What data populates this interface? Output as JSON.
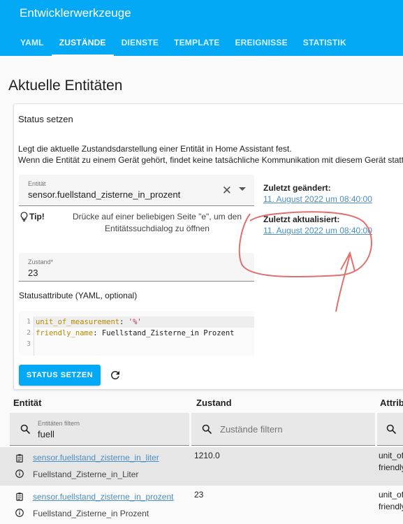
{
  "app_title": "Entwicklerwerkzeuge",
  "tabs": [
    {
      "label": "YAML"
    },
    {
      "label": "ZUSTÄNDE",
      "active": true
    },
    {
      "label": "DIENSTE"
    },
    {
      "label": "TEMPLATE"
    },
    {
      "label": "EREIGNISSE"
    },
    {
      "label": "STATISTIK"
    }
  ],
  "page_title": "Aktuelle Entitäten",
  "set_state": {
    "header": "Status setzen",
    "description_line1": "Legt die aktuelle Zustandsdarstellung einer Entität in Home Assistant fest.",
    "description_line2": "Wenn die Entität zu einem Gerät gehört, findet keine tatsächliche Kommunikation mit diesem Gerät statt.",
    "entity_label": "Entität",
    "entity_value": "sensor.fuellstand_zisterne_in_prozent",
    "tip_label": "Tip!",
    "tip_text": "Drücke auf einer beliebigen Seite \"e\", um den Entitätssuchdialog zu öffnen",
    "state_label": "Zustand*",
    "state_value": "23",
    "attributes_title": "Statusattribute (YAML, optional)",
    "code": {
      "line_numbers": [
        "1",
        "2",
        "3"
      ],
      "line1_key": "unit_of_measurement",
      "line1_colon": ": ",
      "line1_value": "'%'",
      "line2_key": "friendly_name",
      "line2_colon": ": ",
      "line2_value": "Fuellstand_Zisterne_in Prozent"
    },
    "button_label": "STATUS SETZEN",
    "last_changed_label": "Zuletzt geändert:",
    "last_changed_value": "11. August 2022 um 08:40:00",
    "last_updated_label": "Zuletzt aktualisiert:",
    "last_updated_value": "11. August 2022 um 08:40:00"
  },
  "table": {
    "headers": {
      "entity": "Entität",
      "state": "Zustand",
      "attributes": "Attrib"
    },
    "entity_filter_label": "Entitäten filtern",
    "entity_filter_value": "fuell",
    "state_filter_placeholder": "Zustände filtern",
    "rows": [
      {
        "entity_id": "sensor.fuellstand_zisterne_in_liter",
        "friendly_name": "Fuellstand_Zisterne_in_Liter",
        "state": "1210.0",
        "attr_line1": "unit_of",
        "attr_line2": "friendly"
      },
      {
        "entity_id": "sensor.fuellstand_zisterne_in_prozent",
        "friendly_name": "Fuellstand_Zisterne_in Prozent",
        "state": "23",
        "attr_line1": "unit_of",
        "attr_line2": "friendly"
      }
    ]
  },
  "colors": {
    "primary": "#03a9f4",
    "link": "#4a8fc4",
    "annotation": "#e0706e"
  },
  "icons": [
    "close-icon",
    "chevron-down-icon",
    "lightbulb-icon",
    "refresh-icon",
    "search-icon",
    "clipboard-icon",
    "info-icon"
  ]
}
